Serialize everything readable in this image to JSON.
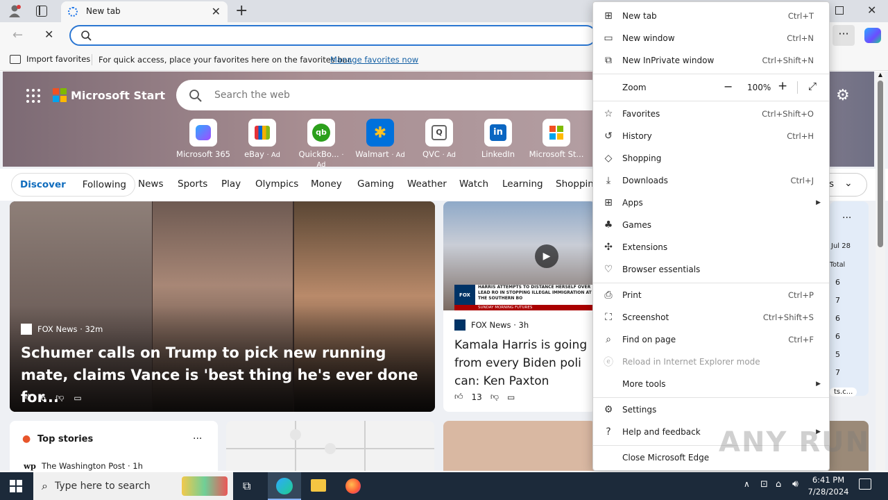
{
  "browser": {
    "tab_title": "New tab",
    "fav_import": "Import favorites",
    "fav_hint": "For quick access, place your favorites here on the favorites bar.",
    "fav_manage": "Manage favorites now"
  },
  "page": {
    "brand": "Microsoft Start",
    "search_placeholder": "Search the web",
    "quicklinks": [
      {
        "label": "Microsoft 365",
        "ad": ""
      },
      {
        "label": "eBay",
        "ad": "· Ad"
      },
      {
        "label": "QuickBo...",
        "ad": "· Ad"
      },
      {
        "label": "Walmart",
        "ad": "· Ad"
      },
      {
        "label": "QVC",
        "ad": "· Ad"
      },
      {
        "label": "LinkedIn",
        "ad": ""
      },
      {
        "label": "Microsoft St...",
        "ad": ""
      }
    ],
    "feed_tabs": {
      "discover": "Discover",
      "following": "Following"
    },
    "nav": [
      "News",
      "Sports",
      "Play",
      "Olympics",
      "Money",
      "Gaming",
      "Weather",
      "Watch",
      "Learning",
      "Shopping"
    ],
    "settings_partial": "gs",
    "story1": {
      "source": "FOX News",
      "age": "· 32m",
      "title": "Schumer calls on Trump to pick new running mate, claims Vance is 'best thing he's ever done for...",
      "likes": "6"
    },
    "story2": {
      "source": "FOX News",
      "age": "· 3h",
      "title": "Kamala Harris is going from every Biden poli can: Ken Paxton",
      "likes": "13",
      "ticker": "HARRIS ATTEMPTS TO DISTANCE HERSELF OVER LEAD RO IN STOPPING ILLEGAL IMMIGRATION AT THE SOUTHERN BO",
      "ticker_sub": "SUNDAY MORNING FUTURES"
    },
    "top_stories": {
      "title": "Top stories",
      "source": "The Washington Post",
      "age": "· 1h"
    },
    "side_panel": {
      "date": "Jul 28",
      "total_label": "Total",
      "values": [
        "6",
        "7",
        "6",
        "6",
        "5",
        "7"
      ],
      "link": "ts.c..."
    }
  },
  "menu": {
    "items": [
      {
        "label": "New tab",
        "shortcut": "Ctrl+T",
        "icon": "new-tab-icon"
      },
      {
        "label": "New window",
        "shortcut": "Ctrl+N",
        "icon": "new-window-icon"
      },
      {
        "label": "New InPrivate window",
        "shortcut": "Ctrl+Shift+N",
        "icon": "inprivate-icon"
      },
      {
        "label": "Zoom",
        "zoom_value": "100%"
      },
      {
        "label": "Favorites",
        "shortcut": "Ctrl+Shift+O",
        "icon": "star-icon"
      },
      {
        "label": "History",
        "shortcut": "Ctrl+H",
        "icon": "history-icon"
      },
      {
        "label": "Shopping",
        "shortcut": "",
        "icon": "tag-icon"
      },
      {
        "label": "Downloads",
        "shortcut": "Ctrl+J",
        "icon": "download-icon"
      },
      {
        "label": "Apps",
        "shortcut": "",
        "icon": "apps-icon"
      },
      {
        "label": "Games",
        "shortcut": "",
        "icon": "games-icon"
      },
      {
        "label": "Extensions",
        "shortcut": "",
        "icon": "puzzle-icon"
      },
      {
        "label": "Browser essentials",
        "shortcut": "",
        "icon": "heart-pulse-icon"
      },
      {
        "label": "Print",
        "shortcut": "Ctrl+P",
        "icon": "printer-icon"
      },
      {
        "label": "Screenshot",
        "shortcut": "Ctrl+Shift+S",
        "icon": "screenshot-icon"
      },
      {
        "label": "Find on page",
        "shortcut": "Ctrl+F",
        "icon": "find-icon"
      },
      {
        "label": "Reload in Internet Explorer mode",
        "shortcut": "",
        "icon": "ie-icon"
      },
      {
        "label": "More tools",
        "shortcut": ""
      },
      {
        "label": "Settings",
        "shortcut": "",
        "icon": "gear-icon"
      },
      {
        "label": "Help and feedback",
        "shortcut": "",
        "icon": "help-icon"
      },
      {
        "label": "Close Microsoft Edge",
        "shortcut": ""
      }
    ]
  },
  "taskbar": {
    "search_placeholder": "Type here to search",
    "time": "6:41 PM",
    "date": "7/28/2024"
  },
  "watermark": "ANY RUN"
}
